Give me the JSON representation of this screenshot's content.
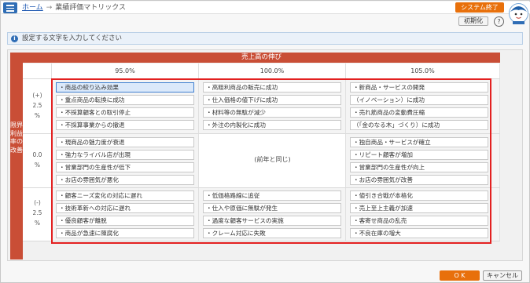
{
  "header": {
    "breadcrumb_home": "ホーム",
    "breadcrumb_sep": "→",
    "page_title": "業績評価マトリックス",
    "system_exit": "システム終了"
  },
  "toolbar": {
    "init_label": "初期化",
    "help_label": "?"
  },
  "info": {
    "text": "設定する文字を入力してください",
    "icon_label": "i"
  },
  "matrix": {
    "top_header": "売上高の伸び",
    "left_header": "限界利益率の改善",
    "columns": [
      "95.0%",
      "100.0%",
      "105.0%"
    ],
    "rows": [
      {
        "sign": "(+)",
        "value": "2.5",
        "unit": "%"
      },
      {
        "sign": "",
        "value": "0.0",
        "unit": "%"
      },
      {
        "sign": "(-)",
        "value": "2.5",
        "unit": "%"
      }
    ],
    "cells": {
      "r0c0": [
        "・商品の絞り込み効果",
        "・重点商品の転換に成功",
        "・不採算顧客との取引停止",
        "・不採算事業からの撤退"
      ],
      "r0c1": [
        "・高粗利商品の販売に成功",
        "・仕入価格の値下げに成功",
        "・材料等の無駄が減少",
        "・外注の内製化に成功"
      ],
      "r0c2": [
        "・新商品・サービスの開発",
        "（イノベーション）に成功",
        "・売れ筋商品の変動費圧縮",
        "（「金のなる木」づくり）に成功"
      ],
      "r1c0": [
        "・現商品の魅力度が衰退",
        "・強力なライバル店が出現",
        "・営業部門の生産性が低下",
        "・お店の雰囲気が悪化"
      ],
      "r1c1_same": "(前年と同じ)",
      "r1c2": [
        "・独自商品・サービスが確立",
        "・リピート顧客が増加",
        "・営業部門の生産性が向上",
        "・お店の雰囲気が改善"
      ],
      "r2c0": [
        "・顧客ニーズ変化の対応に遅れ",
        "・技術革新への対応に遅れ",
        "・優良顧客が離脱",
        "・商品が急速に陳腐化"
      ],
      "r2c1": [
        "・低価格路線に追従",
        "・仕入や原価に無駄が発生",
        "・過度な顧客サービスの実施",
        "・クレーム対応に失敗"
      ],
      "r2c2": [
        "・値引き合戦が本格化",
        "・売上至上主義が加速",
        "・客寄せ商品の乱売",
        "・不良在庫の増大"
      ]
    }
  },
  "footer": {
    "ok_label": "O K",
    "cancel_label": "キャンセル"
  },
  "colors": {
    "accent_orange": "#e8700b",
    "header_red": "#c94e36",
    "menu_blue": "#2f6db5",
    "highlight_red": "#e32020"
  },
  "icons": {
    "menu": "hamburger-menu-icon",
    "help": "question-mark-icon",
    "info": "info-icon",
    "mascot": "mascot-character-icon"
  }
}
